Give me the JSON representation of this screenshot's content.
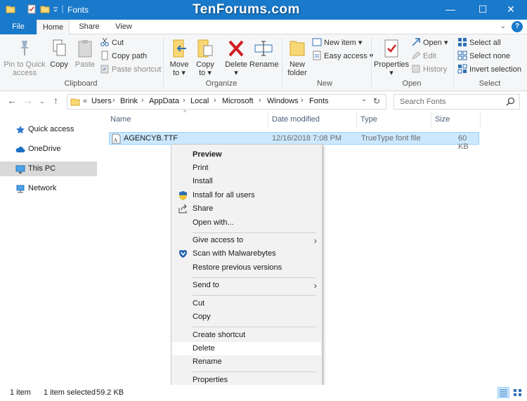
{
  "window": {
    "title": "Fonts",
    "watermark": "TenForums.com",
    "controls": {
      "minimize": "—",
      "maximize": "☐",
      "close": "✕"
    }
  },
  "ribbon_tabs": {
    "file": "File",
    "home": "Home",
    "share": "Share",
    "view": "View",
    "help": "?"
  },
  "ribbon": {
    "clipboard": {
      "pin": "Pin to Quick access",
      "pin_l1": "Pin to Quick",
      "pin_l2": "access",
      "copy": "Copy",
      "paste": "Paste",
      "cut": "Cut",
      "copy_path": "Copy path",
      "paste_shortcut": "Paste shortcut",
      "label": "Clipboard"
    },
    "organize": {
      "move_to_l1": "Move",
      "move_to_l2": "to ▾",
      "copy_to_l1": "Copy",
      "copy_to_l2": "to ▾",
      "delete_l1": "Delete",
      "delete_l2": "▾",
      "rename": "Rename",
      "label": "Organize"
    },
    "new": {
      "new_folder_l1": "New",
      "new_folder_l2": "folder",
      "new_item": "New item ▾",
      "easy_access": "Easy access ▾",
      "label": "New"
    },
    "open": {
      "properties_l1": "Properties",
      "properties_l2": "▾",
      "open": "Open ▾",
      "edit": "Edit",
      "history": "History",
      "label": "Open"
    },
    "select": {
      "select_all": "Select all",
      "select_none": "Select none",
      "invert": "Invert selection",
      "label": "Select"
    }
  },
  "address": {
    "overflow": "«",
    "crumbs": [
      "Users",
      "Brink",
      "AppData",
      "Local",
      "Microsoft",
      "Windows",
      "Fonts"
    ],
    "separator": "›",
    "search_placeholder": "Search Fonts"
  },
  "nav_pane": {
    "items": [
      {
        "label": "Quick access",
        "icon": "star-icon"
      },
      {
        "label": "OneDrive",
        "icon": "cloud-icon"
      },
      {
        "label": "This PC",
        "icon": "computer-icon"
      },
      {
        "label": "Network",
        "icon": "network-icon"
      }
    ]
  },
  "file_list": {
    "columns": {
      "name": "Name",
      "date": "Date modified",
      "type": "Type",
      "size": "Size"
    },
    "rows": [
      {
        "name": "AGENCYB.TTF",
        "date": "12/16/2018 7:08 PM",
        "type": "TrueType font file",
        "size": "60 KB"
      }
    ]
  },
  "context_menu": {
    "items": {
      "preview": "Preview",
      "print": "Print",
      "install": "Install",
      "install_all": "Install for all users",
      "share": "Share",
      "open_with": "Open with...",
      "give_access": "Give access to",
      "malwarebytes": "Scan with Malwarebytes",
      "restore": "Restore previous versions",
      "send_to": "Send to",
      "cut": "Cut",
      "copy": "Copy",
      "create_shortcut": "Create shortcut",
      "delete": "Delete",
      "rename": "Rename",
      "properties": "Properties"
    },
    "submenu_arrow": "›"
  },
  "status_bar": {
    "count": "1 item",
    "selected": "1 item selected",
    "size": "59.2 KB"
  },
  "colors": {
    "title_bar": "#1979ca",
    "selection": "#cce8ff",
    "ribbon_bg": "#f5f6f7",
    "menu_bg": "#f2f2f2"
  }
}
